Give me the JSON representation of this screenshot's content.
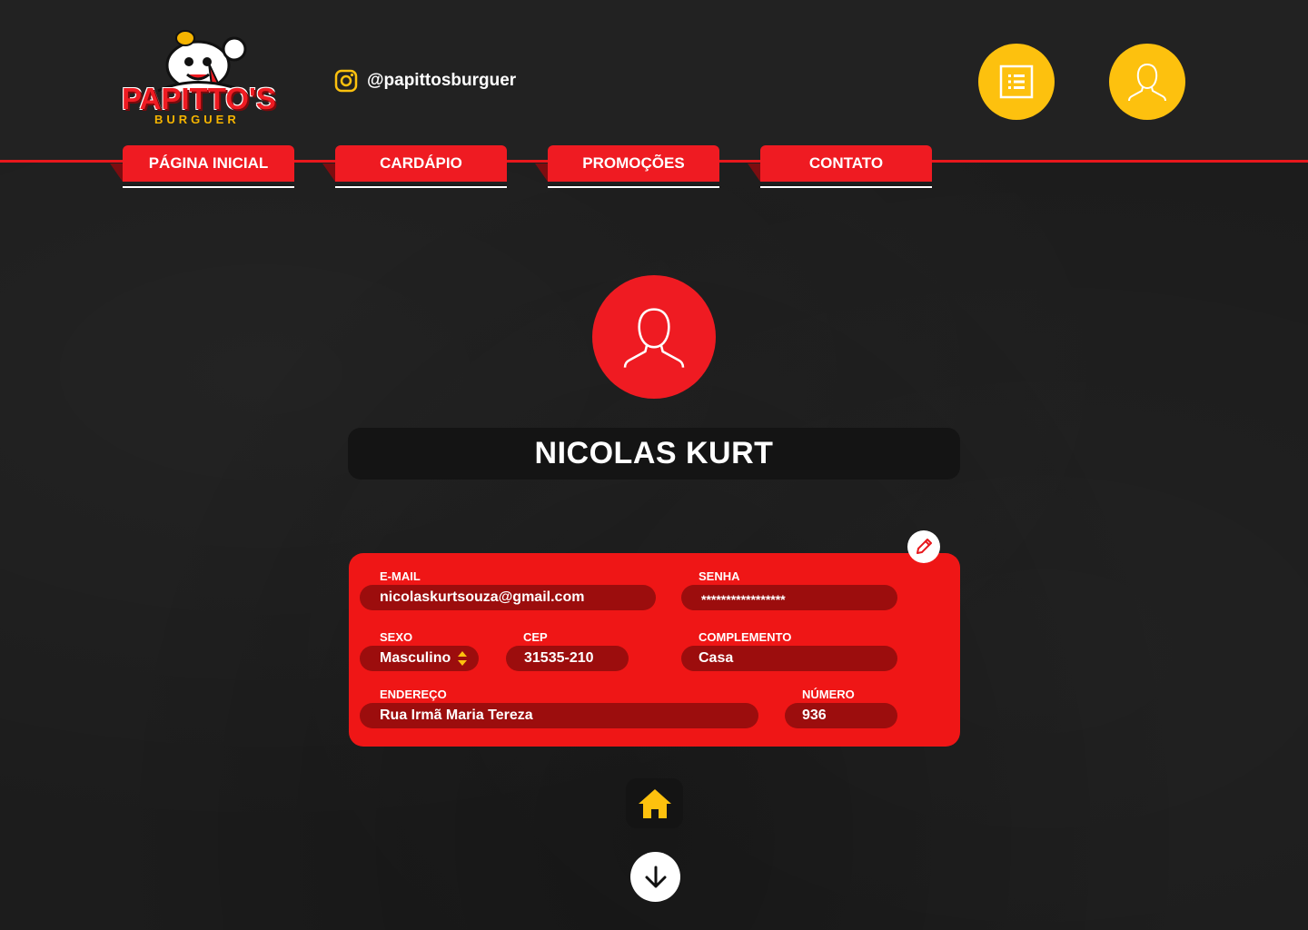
{
  "brand": {
    "logo_title": "PAPITTO'S",
    "logo_subtitle": "BURGUER"
  },
  "social": {
    "instagram_handle": "@papittosburguer",
    "icon": "instagram-icon"
  },
  "header_buttons": [
    {
      "icon": "list-icon"
    },
    {
      "icon": "user-icon"
    }
  ],
  "nav": {
    "items": [
      {
        "label": "PÁGINA INICIAL"
      },
      {
        "label": "CARDÁPIO"
      },
      {
        "label": "PROMOÇÕES"
      },
      {
        "label": "CONTATO"
      }
    ]
  },
  "profile": {
    "name": "NICOLAS KURT",
    "fields": {
      "email_label": "E-MAIL",
      "email_value": "nicolaskurtsouza@gmail.com",
      "password_label": "SENHA",
      "password_value": "*****************",
      "sex_label": "SEXO",
      "sex_value": "Masculino",
      "cep_label": "CEP",
      "cep_value": "31535-210",
      "complement_label": "COMPLEMENTO",
      "complement_value": "Casa",
      "address_label": "ENDEREÇO",
      "address_value": "Rua Irmã Maria Tereza",
      "number_label": "NÚMERO",
      "number_value": "936"
    }
  },
  "colors": {
    "accent_red": "#ef1b22",
    "accent_yellow": "#fdc10e",
    "field_dark_red": "#9c0d0d",
    "background": "#1c1c1c"
  }
}
